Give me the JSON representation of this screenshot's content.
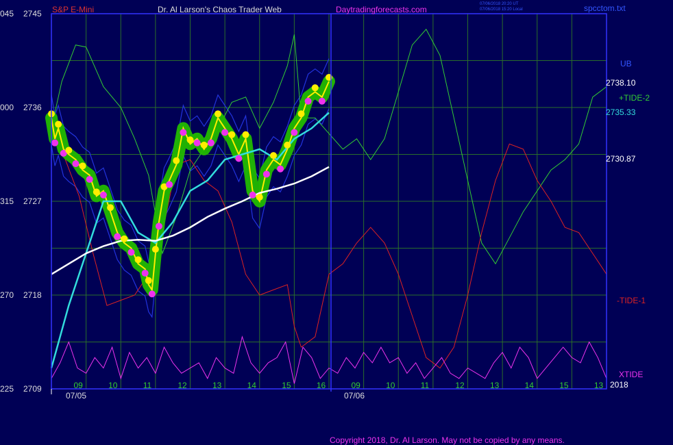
{
  "header": {
    "symbol": "S&P E-Mini",
    "title": "Dr. Al Larson's Chaos Trader Web",
    "site": "Daytradingforecasts.com",
    "timestamp_ut": "07/06/2018 20:20 UT",
    "timestamp_local": "07/06/2018 15:20 Local",
    "file": "spcctom.txt"
  },
  "footer": {
    "copyright": "Copyright 2018, Dr. Al Larson. May not be copied by any means."
  },
  "colors": {
    "background": "#000055",
    "grid": "#2a6e2a",
    "frame": "#3333ff",
    "tide_plus2": "#33cc33",
    "tide_minus1": "#dd2222",
    "xtide": "#ee33ee",
    "price": "#ffee00",
    "highlight": "#22bb00",
    "ma_fast": "#33dddd",
    "ma_slow": "#ffffff",
    "band": "#2233dd",
    "text_axis": "#dddddd",
    "text_time": "#33cc33"
  },
  "chart_data": {
    "type": "line",
    "title": "S&P E-Mini",
    "y_ticks": [
      {
        "left": "045",
        "price": "2745",
        "value": 2745
      },
      {
        "left": "000",
        "price": "2736",
        "value": 2736
      },
      {
        "left": "315",
        "price": "2727",
        "value": 2727
      },
      {
        "left": "270",
        "price": "2718",
        "value": 2718
      },
      {
        "left": "225",
        "price": "2709",
        "value": 2709
      }
    ],
    "ylim": [
      2709,
      2745
    ],
    "x_hour_labels": [
      "09",
      "10",
      "11",
      "12",
      "13",
      "14",
      "15",
      "16",
      "09",
      "10",
      "11",
      "12",
      "13",
      "14",
      "15",
      "13"
    ],
    "date_labels": [
      "07/05",
      "07/06"
    ],
    "right_labels": {
      "ub": "UB",
      "tide_plus2": "+TIDE-2",
      "tide_minus1": "-TIDE-1",
      "xtide": "XTIDE",
      "year": "2018",
      "price_1": "2738.10",
      "price_2": "2735.33",
      "price_3": "2730.87"
    },
    "series": [
      {
        "name": "+TIDE-2",
        "x": [
          0,
          0.3,
          0.7,
          1.0,
          1.5,
          2.0,
          2.4,
          2.8,
          3.2,
          3.6,
          4.0,
          4.4,
          4.8,
          5.2,
          5.6,
          6.0,
          6.4,
          6.8,
          7.0,
          7.2,
          7.6,
          8.0,
          8.4,
          8.8,
          9.2,
          9.6,
          10.0,
          10.4,
          10.8,
          11.2,
          11.6,
          12.0,
          12.4,
          12.8,
          13.2,
          13.6,
          14.0,
          14.4,
          14.8,
          15.2,
          15.6,
          16.0
        ],
        "y": [
          2734,
          2738.5,
          2742,
          2741.8,
          2738,
          2736,
          2733,
          2729.5,
          2722,
          2725.5,
          2730,
          2732,
          2734,
          2736.5,
          2737,
          2734,
          2736.5,
          2740,
          2743,
          2735,
          2735,
          2733.5,
          2732,
          2733,
          2731,
          2733,
          2737.5,
          2742,
          2743.5,
          2741,
          2735,
          2729,
          2723,
          2721,
          2723.5,
          2726,
          2728,
          2730,
          2731,
          2732.5,
          2737,
          2738
        ]
      },
      {
        "name": "-TIDE-1",
        "x": [
          0,
          0.4,
          0.8,
          1.2,
          1.6,
          2.0,
          2.4,
          2.8,
          3.2,
          3.6,
          4.0,
          4.4,
          4.8,
          5.2,
          5.6,
          6.0,
          6.4,
          6.8,
          7.0,
          7.2,
          7.6,
          8.0,
          8.4,
          8.8,
          9.2,
          9.6,
          10.0,
          10.4,
          10.8,
          11.2,
          11.6,
          12.0,
          12.4,
          12.8,
          13.2,
          13.6,
          14.0,
          14.4,
          14.8,
          15.2,
          15.6,
          16.0
        ],
        "y": [
          2734.5,
          2731,
          2727.5,
          2722,
          2717,
          2717.5,
          2718,
          2720,
          2724,
          2730.5,
          2731,
          2729,
          2728,
          2725,
          2720,
          2718,
          2718.5,
          2719,
          2715,
          2713,
          2714,
          2720,
          2721,
          2723,
          2724.5,
          2723,
          2720,
          2716,
          2712,
          2711,
          2713,
          2718,
          2724,
          2729,
          2732.5,
          2732,
          2729,
          2727,
          2724.5,
          2724,
          2722,
          2720
        ]
      },
      {
        "name": "XTIDE",
        "x": [
          0,
          0.25,
          0.5,
          0.75,
          1,
          1.25,
          1.5,
          1.75,
          2,
          2.25,
          2.5,
          2.75,
          3,
          3.25,
          3.5,
          3.75,
          4,
          4.25,
          4.5,
          4.75,
          5,
          5.25,
          5.5,
          5.75,
          6,
          6.25,
          6.5,
          6.75,
          7,
          7.25,
          7.5,
          7.75,
          8,
          8.25,
          8.5,
          8.75,
          9,
          9.25,
          9.5,
          9.75,
          10,
          10.25,
          10.5,
          10.75,
          11,
          11.25,
          11.5,
          11.75,
          12,
          12.25,
          12.5,
          12.75,
          13,
          13.25,
          13.5,
          13.75,
          14,
          14.25,
          14.5,
          14.75,
          15,
          15.25,
          15.5,
          15.75,
          16
        ],
        "y": [
          2710,
          2711.5,
          2713.5,
          2711,
          2710.5,
          2712,
          2711,
          2713,
          2710,
          2712.5,
          2711,
          2712,
          2710.5,
          2713,
          2711.5,
          2710.5,
          2711,
          2711.5,
          2710,
          2712,
          2711,
          2710.5,
          2714,
          2711.5,
          2710.5,
          2711.5,
          2712,
          2713.5,
          2709.5,
          2713,
          2712,
          2710,
          2711,
          2710.5,
          2712,
          2711,
          2712.5,
          2711.5,
          2713,
          2711.5,
          2712,
          2710.5,
          2711.5,
          2710,
          2711,
          2712,
          2710.5,
          2710,
          2711,
          2710.5,
          2710,
          2711.5,
          2712.5,
          2711,
          2713,
          2712,
          2710,
          2711,
          2712,
          2713,
          2712,
          2711.5,
          2713.5,
          2712,
          2710
        ]
      },
      {
        "name": "Price",
        "x": [
          0,
          0.1,
          0.2,
          0.35,
          0.5,
          0.7,
          0.9,
          1.1,
          1.3,
          1.5,
          1.7,
          1.9,
          2.1,
          2.3,
          2.5,
          2.7,
          2.8,
          2.9,
          3.0,
          3.1,
          3.25,
          3.4,
          3.6,
          3.8,
          4.0,
          4.2,
          4.4,
          4.6,
          4.8,
          5.0,
          5.2,
          5.4,
          5.6,
          5.8,
          6.0,
          6.2,
          6.4,
          6.6,
          6.8,
          7.0,
          7.2,
          7.4,
          7.6,
          7.8,
          8.0
        ],
        "y": [
          2735,
          2733,
          2734,
          2732,
          2731.5,
          2731,
          2730,
          2729.5,
          2727.5,
          2728,
          2726,
          2724,
          2723,
          2722.5,
          2721,
          2720.5,
          2719,
          2718.5,
          2722,
          2725,
          2728,
          2729,
          2730.5,
          2734,
          2732.5,
          2733,
          2732,
          2733,
          2735,
          2734,
          2733,
          2731.5,
          2733,
          2728,
          2727,
          2730,
          2731,
          2730.5,
          2732,
          2734,
          2735,
          2737,
          2737.5,
          2737,
          2738.5
        ]
      },
      {
        "name": "MA-fast",
        "x": [
          0,
          0.5,
          1,
          1.5,
          2,
          2.5,
          3,
          3.5,
          4,
          4.5,
          5,
          5.5,
          6,
          6.5,
          7,
          7.5,
          8
        ],
        "y": [
          2711,
          2717,
          2722,
          2727,
          2727,
          2724,
          2723,
          2725,
          2728,
          2729,
          2731,
          2731.5,
          2732,
          2731,
          2733,
          2734,
          2735.5
        ]
      },
      {
        "name": "MA-slow",
        "x": [
          0,
          0.5,
          1,
          1.5,
          2,
          2.5,
          3,
          3.5,
          4,
          4.5,
          5,
          5.5,
          6,
          6.5,
          7,
          7.5,
          8
        ],
        "y": [
          2720,
          2721,
          2722,
          2722.7,
          2723.2,
          2723.3,
          2723.2,
          2723.7,
          2724.5,
          2725.5,
          2726.3,
          2727,
          2727.8,
          2728.2,
          2728.7,
          2729.4,
          2730.3
        ]
      }
    ]
  }
}
